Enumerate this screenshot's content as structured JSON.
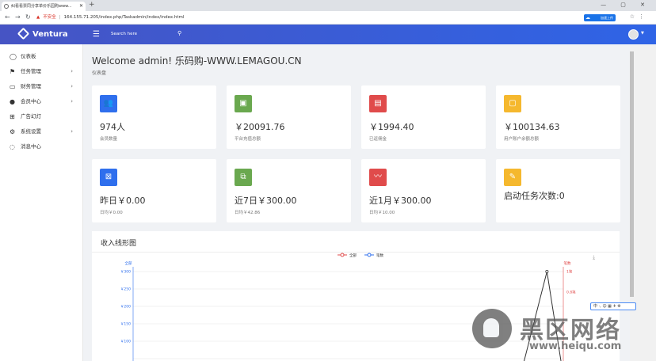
{
  "browser": {
    "tab_title": "纠看看票同分享单价乐园购www...",
    "url_warning": "不安全",
    "url": "164.155.71.205/index.php/Taskadmin/index/index.html",
    "ext_badge": "加速上传",
    "window_controls": "— ▢ ✕"
  },
  "header": {
    "brand": "Ventura",
    "search_placeholder": "Search here"
  },
  "sidebar": {
    "items": [
      {
        "label": "仪表板",
        "icon": "dashboard-icon",
        "glyph": "◯",
        "arrow": false
      },
      {
        "label": "任务管理",
        "icon": "flag-icon",
        "glyph": "⚑",
        "arrow": true
      },
      {
        "label": "财务管理",
        "icon": "drive-icon",
        "glyph": "▭",
        "arrow": true
      },
      {
        "label": "会员中心",
        "icon": "user-icon",
        "glyph": "●",
        "arrow": true
      },
      {
        "label": "广告幻灯",
        "icon": "grid-icon",
        "glyph": "⊞",
        "arrow": false
      },
      {
        "label": "系统设置",
        "icon": "gear-icon",
        "glyph": "⚙",
        "arrow": true
      },
      {
        "label": "消息中心",
        "icon": "message-icon",
        "glyph": "◌",
        "arrow": false
      }
    ]
  },
  "main": {
    "welcome": "Welcome admin! 乐码购-WWW.LEMAGOU.CN",
    "subtitle": "仪表盘"
  },
  "stats_row1": [
    {
      "value": "974人",
      "label": "会员数量",
      "color": "#2f6fed",
      "icon": "users-icon",
      "glyph": "👥"
    },
    {
      "value": "￥20091.76",
      "label": "平台充值总额",
      "color": "#6aa84f",
      "icon": "money-icon",
      "glyph": "▣"
    },
    {
      "value": "￥1994.40",
      "label": "已返佣金",
      "color": "#e04b4b",
      "icon": "card-icon",
      "glyph": "▤"
    },
    {
      "value": "￥100134.63",
      "label": "用户账户余额总额",
      "color": "#f5b82e",
      "icon": "folder-icon",
      "glyph": "▢"
    }
  ],
  "stats_row2": [
    {
      "value": "昨日￥0.00",
      "label": "日均￥0.00",
      "color": "#2f6fed",
      "icon": "screen-icon",
      "glyph": "⊠"
    },
    {
      "value": "近7日￥300.00",
      "label": "日均￥42.86",
      "color": "#6aa84f",
      "icon": "copy-icon",
      "glyph": "⧉"
    },
    {
      "value": "近1月￥300.00",
      "label": "日均￥10.00",
      "color": "#e04b4b",
      "icon": "trend-icon",
      "glyph": "〰"
    },
    {
      "value": "启动任务次数:0",
      "label": "",
      "color": "#f5b82e",
      "icon": "tool-icon",
      "glyph": "✎"
    }
  ],
  "chart": {
    "title": "收入线形图"
  },
  "chart_data": {
    "type": "line",
    "legend": [
      "全部",
      "笔数"
    ],
    "legend_position": "top-center",
    "y_left_label": "全部",
    "y_right_label": "笔数",
    "y_left_ticks": [
      "￥300",
      "￥250",
      "￥200",
      "￥150",
      "￥100"
    ],
    "y_right_ticks": [
      "1笔",
      "0.8笔"
    ],
    "ylim_left": [
      0,
      300
    ],
    "ylim_right": [
      0,
      1
    ],
    "grid": true,
    "series": [
      {
        "name": "全部",
        "color": "#333333",
        "points": [
          [
            0.9,
            0
          ],
          [
            0.962,
            300
          ],
          [
            1.0,
            0
          ]
        ]
      }
    ]
  },
  "ime": {
    "text": "中 ·,  ☺ ▦ ✈ ⚙"
  },
  "watermark": {
    "text": "黑区网络",
    "url": "www.heiqu.com"
  }
}
